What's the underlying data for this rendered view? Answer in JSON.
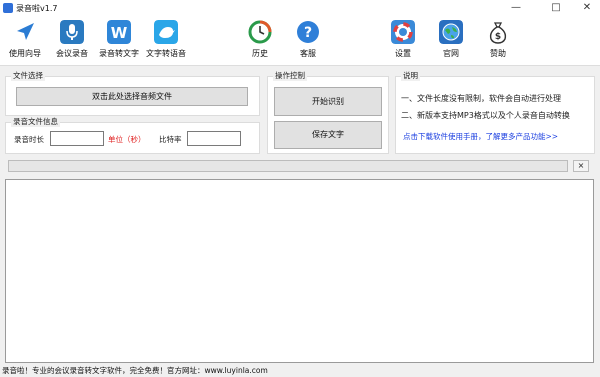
{
  "window": {
    "title": "录音啦v1.7",
    "minimize": "—",
    "maximize": "□",
    "close": "✕"
  },
  "toolbar": {
    "items": [
      {
        "label": "使用向导",
        "icon": "navigate-arrow-icon",
        "color": "#2b7cd3"
      },
      {
        "label": "会议录音",
        "icon": "microphone-icon",
        "color": "#2a7ac0"
      },
      {
        "label": "录音转文字",
        "icon": "word-w-icon",
        "color": "#2f86d8"
      },
      {
        "label": "文字转语音",
        "icon": "bird-speech-icon",
        "color": "#2aa6e8"
      },
      {
        "label": "历史",
        "icon": "history-clock-icon",
        "color": "#e05a2a"
      },
      {
        "label": "客服",
        "icon": "question-icon",
        "color": "#2f7fd8"
      },
      {
        "label": "设置",
        "icon": "lifebuoy-settings-icon",
        "color": "#e04040"
      },
      {
        "label": "官网",
        "icon": "globe-icon",
        "color": "#2a6fc0"
      },
      {
        "label": "赞助",
        "icon": "money-bag-icon",
        "color": "#333333"
      }
    ]
  },
  "file_select": {
    "title": "文件选择",
    "button": "双击此处选择音频文件"
  },
  "audio_info": {
    "title": "录音文件信息",
    "duration_label": "录音时长",
    "duration_value": "",
    "unit_label": "单位（秒）",
    "bitrate_label": "比特率",
    "bitrate_value": ""
  },
  "operations": {
    "title": "操作控制",
    "start_button": "开始识别",
    "save_button": "保存文字"
  },
  "notes": {
    "title": "说明",
    "line1": "一、文件长度没有限制，软件会自动进行处理",
    "line2": "二、新版本支持MP3格式以及个人录音自动转换",
    "link": "点击下载软件使用手册，了解更多产品功能>>"
  },
  "progress": {
    "value": 0,
    "close": "×"
  },
  "transcript": {
    "text": ""
  },
  "status_bar": "录音啦！专业的会议录音转文字软件，完全免费！官方网址：www.luyinla.com",
  "colors": {
    "accent_red": "#e02020",
    "link_blue": "#1a3ee0"
  }
}
